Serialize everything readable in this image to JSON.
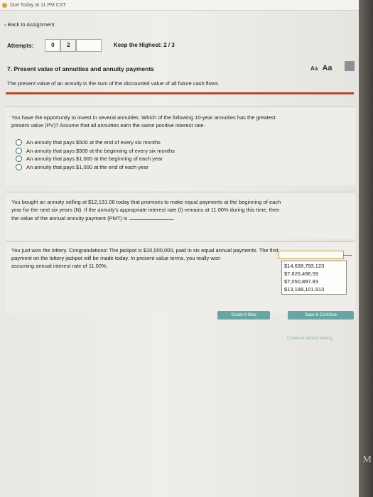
{
  "topbar": {
    "due_text": "Due Today at 11 PM CST"
  },
  "nav": {
    "back_label": "‹ Back to Assignment"
  },
  "attempts": {
    "label": "Attempts:",
    "box_left": "0",
    "box_mid": "2",
    "box_right": "",
    "keep_label": "Keep the Highest: 2 / 3"
  },
  "question": {
    "title": "7. Present value of annuities and annuity payments",
    "text_size_small": "Aa",
    "text_size_large": "Aa",
    "intro": "The present value of an annuity is the sum of the discounted value of all future cash flows."
  },
  "part1": {
    "prompt_line1": "You have the opportunity to invest in several annuities. Which of the following 10-year annuities has the greatest",
    "prompt_line2": "present value (PV)? Assume that all annuities earn the same positive interest rate.",
    "options": [
      "An annuity that pays $500 at the end of every six months",
      "An annuity that pays $500 at the beginning of every six months",
      "An annuity that pays $1,000 at the beginning of each year",
      "An annuity that pays $1,000 at the end of each year"
    ]
  },
  "part2": {
    "line1": "You bought an annuity selling at $12,131.06 today that promises to make equal payments at the beginning of each",
    "line2": "year for the next six years (N). If the annuity's appropriate interest rate (I) remains at 11.00% during this time, then",
    "line3": "the value of the annual annuity payment (PMT) is",
    "end": "."
  },
  "part3": {
    "line1": "You just won the lottery. Congratulations! The jackpot is $10,000,000, paid in six equal annual payments. The first",
    "line2": "payment on the lottery jackpot will be made today. In present value terms, you really won",
    "line3": "assuming annual interest rate of 11.00%.",
    "dropdown_options": [
      "$14,638,793.123",
      "$7,826,496.59",
      "$7,050,897.83",
      "$13,188,101.913"
    ]
  },
  "footer": {
    "grade_label": "Grade It Now",
    "save_label": "Save & Continue",
    "continue_label": "Continue without saving"
  }
}
